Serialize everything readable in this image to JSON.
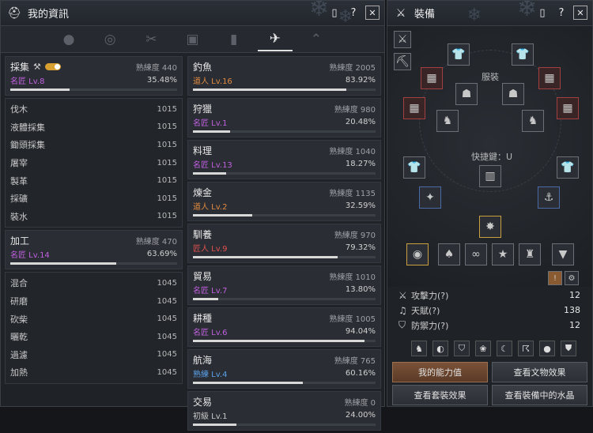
{
  "colors": {
    "accent_purple": "#c060e0",
    "accent_orange": "#e08a40",
    "accent_blue": "#5aa0e8",
    "bar": "#d8d8d8"
  },
  "left": {
    "title": "我的資訊",
    "tabs": [
      "person-icon",
      "medal-icon",
      "tools-icon",
      "gift-icon",
      "chart-icon",
      "life-skill-icon",
      "chevron-up-icon"
    ],
    "gathering": {
      "name": "採集",
      "prof_label": "熟練度 440",
      "level": "名匠 Lv.8",
      "pct": "35.48%",
      "progress": 0.3548,
      "subs": [
        [
          "伐木",
          "1015"
        ],
        [
          "液體採集",
          "1015"
        ],
        [
          "鋤頭採集",
          "1015"
        ],
        [
          "屠宰",
          "1015"
        ],
        [
          "製革",
          "1015"
        ],
        [
          "採礦",
          "1015"
        ],
        [
          "裝水",
          "1015"
        ]
      ]
    },
    "processing": {
      "name": "加工",
      "prof_label": "熟練度 470",
      "level": "名匠 Lv.14",
      "pct": "63.69%",
      "progress": 0.6369,
      "subs": [
        [
          "混合",
          "1045"
        ],
        [
          "研磨",
          "1045"
        ],
        [
          "砍柴",
          "1045"
        ],
        [
          "曬乾",
          "1045"
        ],
        [
          "過濾",
          "1045"
        ],
        [
          "加熱",
          "1045"
        ]
      ]
    },
    "skills": [
      {
        "name": "釣魚",
        "prof_label": "熟練度 2005",
        "level": "道人 Lv.16",
        "pct": "83.92%",
        "progress": 0.8392,
        "color": "#e08a40"
      },
      {
        "name": "狩獵",
        "prof_label": "熟練度 980",
        "level": "名匠 Lv.1",
        "pct": "20.48%",
        "progress": 0.2048,
        "color": "#c060e0"
      },
      {
        "name": "料理",
        "prof_label": "熟練度 1040",
        "level": "名匠 Lv.13",
        "pct": "18.27%",
        "progress": 0.1827,
        "color": "#c060e0"
      },
      {
        "name": "煉金",
        "prof_label": "熟練度 1135",
        "level": "道人 Lv.2",
        "pct": "32.59%",
        "progress": 0.3259,
        "color": "#e08a40"
      },
      {
        "name": "馴養",
        "prof_label": "熟練度 970",
        "level": "匠人 Lv.9",
        "pct": "79.32%",
        "progress": 0.7932,
        "color": "#e05050"
      },
      {
        "name": "貿易",
        "prof_label": "熟練度 1010",
        "level": "名匠 Lv.7",
        "pct": "13.80%",
        "progress": 0.138,
        "color": "#c060e0"
      },
      {
        "name": "耕種",
        "prof_label": "熟練度 1005",
        "level": "名匠 Lv.6",
        "pct": "94.04%",
        "progress": 0.9404,
        "color": "#c060e0"
      },
      {
        "name": "航海",
        "prof_label": "熟練度 765",
        "level": "熟練 Lv.4",
        "pct": "60.16%",
        "progress": 0.6016,
        "color": "#5aa0e8"
      },
      {
        "name": "交易",
        "prof_label": "熟練度 0",
        "level": "初級 Lv.1",
        "pct": "24.00%",
        "progress": 0.24,
        "color": "#c8c8c8"
      }
    ]
  },
  "right": {
    "title": "裝備",
    "outfit_label": "服裝",
    "hotkey_label": "快捷鍵：U",
    "stats": [
      {
        "icon": "sword-icon",
        "name": "攻擊力(?)",
        "value": "12"
      },
      {
        "icon": "note-icon",
        "name": "天賦(?)",
        "value": "138"
      },
      {
        "icon": "shield-icon",
        "name": "防禦力(?)",
        "value": "12"
      }
    ],
    "buttons": {
      "ability": "我的能力值",
      "artifact": "查看文物效果",
      "set": "查看套裝效果",
      "crystal": "查看裝備中的水晶"
    }
  }
}
